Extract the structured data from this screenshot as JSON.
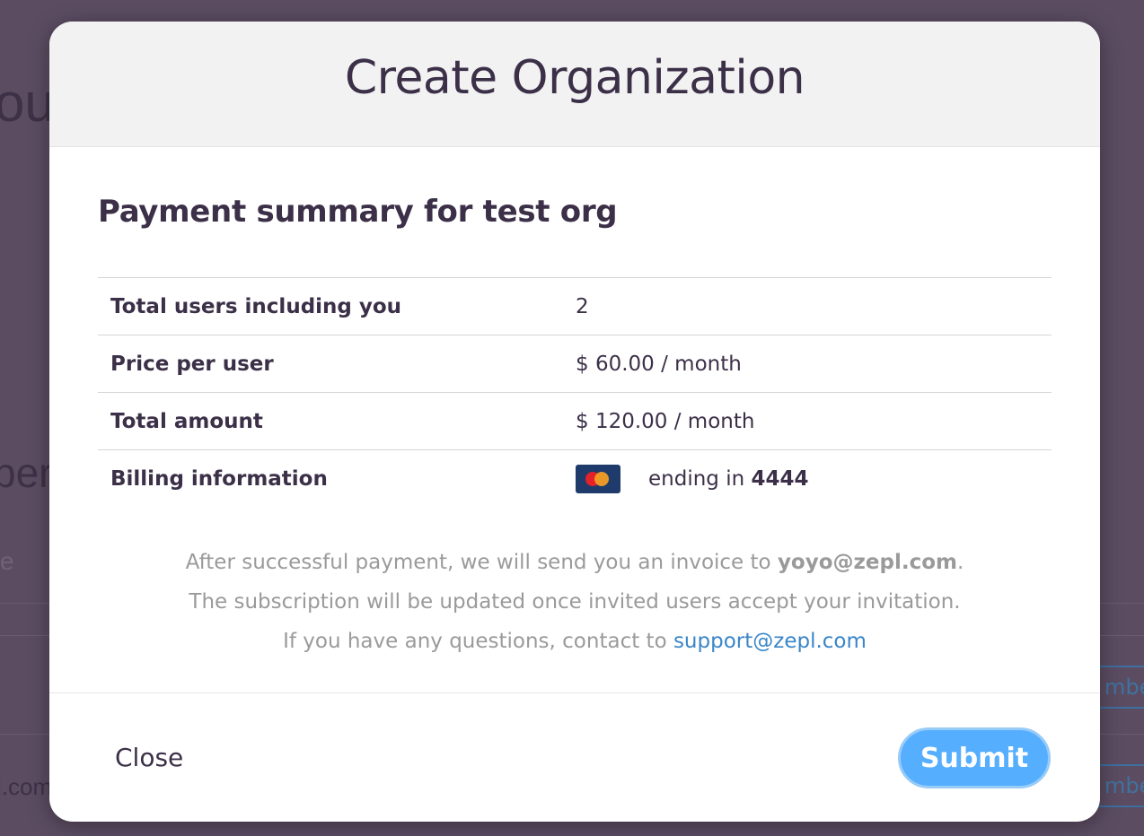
{
  "background": {
    "heading_1": "ou",
    "heading_2": "ber",
    "placeholder": "e",
    "email_fragment": "l.com",
    "button_fragment": "mbe"
  },
  "modal": {
    "title": "Create Organization",
    "summary_prefix": "Payment summary for",
    "org_name": "test org",
    "rows": [
      {
        "label": "Total users including you",
        "value": "2"
      },
      {
        "label": "Price per user",
        "value": "$ 60.00 / month"
      },
      {
        "label": "Total amount",
        "value": "$ 120.00 / month"
      },
      {
        "label": "Billing information",
        "card_icon": "mastercard-icon",
        "ending_text": "ending in",
        "card_last4": "4444"
      }
    ],
    "notes": {
      "line1_prefix": "After successful payment, we will send you an invoice to",
      "invoice_email": "yoyo@zepl.com",
      "line1_suffix": ".",
      "line2": "The subscription will be updated once invited users accept your invitation.",
      "line3_prefix": "If you have any questions, contact to",
      "support_email": "support@zepl.com"
    },
    "footer": {
      "close_label": "Close",
      "submit_label": "Submit"
    }
  },
  "colors": {
    "overlay": "#5b4c62",
    "submit_bg": "#56aeff",
    "link": "#3a86c8",
    "text_dark": "#3c3048"
  }
}
